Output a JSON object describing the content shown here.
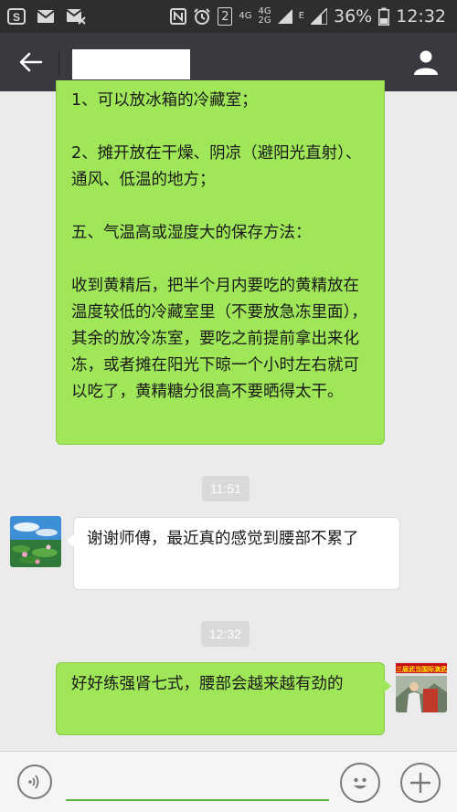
{
  "status_bar": {
    "network_small_top": "4G",
    "network_small_bottom": "2G",
    "network_small_top2": "4G",
    "signal_type": "E",
    "sim_badge": "2",
    "battery": "36%",
    "time": "12:32"
  },
  "chat": {
    "messages": [
      {
        "lines": [
          "1、可以放冰箱的冷藏室；",
          "",
          "2、摊开放在干燥、阴凉（避阳光直射）、通风、低温的地方；",
          "",
          "五、气温高或湿度大的保存方法：",
          "",
          "收到黄精后，把半个月内要吃的黄精放在温度较低的冷藏室里（不要放急冻里面），其余的放冷冻室，要吃之前提前拿出来化冻，或者摊在阳光下晾一个小时左右就可以吃了，黄精糖分很高不要晒得太干。"
        ]
      },
      {
        "time": "11:51"
      },
      {
        "text": "谢谢师傅，最近真的感觉到腰部不累了"
      },
      {
        "time": "12:32"
      },
      {
        "text": "好好练强肾七式，腰部会越来越有劲的"
      }
    ]
  },
  "avatar_right_banner": "第三届武当国际演武大",
  "colors": {
    "bubble_green": "#9fe658",
    "title_bar": "#393a3f",
    "status_bar": "#2e2e2e",
    "input_underline": "#59b33b"
  },
  "icons": {
    "back": "arrow-left-icon",
    "profile": "person-icon",
    "voice": "voice-wave-icon",
    "emoji": "smiley-icon",
    "more": "plus-icon"
  }
}
